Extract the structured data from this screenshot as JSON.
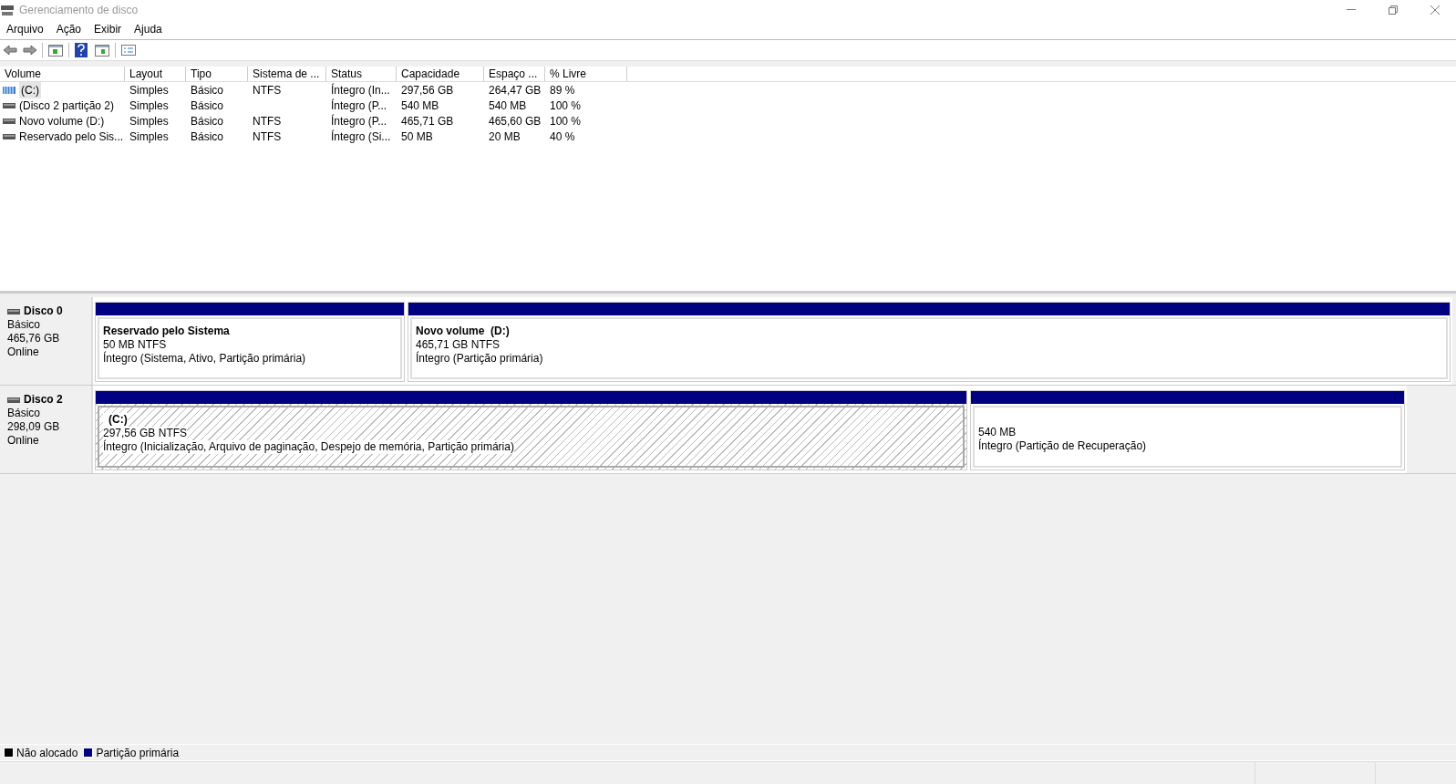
{
  "window": {
    "title": "Gerenciamento de disco"
  },
  "menu": [
    "Arquivo",
    "Ação",
    "Exibir",
    "Ajuda"
  ],
  "table": {
    "columns": [
      "Volume",
      "Layout",
      "Tipo",
      "Sistema de ...",
      "Status",
      "Capacidade",
      "Espaço ...",
      "% Livre"
    ],
    "rows": [
      {
        "kind": "boot",
        "selected": true,
        "cells": [
          "(C:)",
          "Simples",
          "Básico",
          "NTFS",
          "Íntegro (In...",
          "297,56 GB",
          "264,47 GB",
          "89 %"
        ]
      },
      {
        "kind": "drive",
        "selected": false,
        "cells": [
          "(Disco 2 partição 2)",
          "Simples",
          "Básico",
          "",
          "Íntegro (P...",
          "540 MB",
          "540 MB",
          "100 %"
        ]
      },
      {
        "kind": "drive",
        "selected": false,
        "cells": [
          "Novo volume (D:)",
          "Simples",
          "Básico",
          "NTFS",
          "Íntegro (P...",
          "465,71 GB",
          "465,60 GB",
          "100 %"
        ]
      },
      {
        "kind": "drive",
        "selected": false,
        "cells": [
          "Reservado pelo Sis...",
          "Simples",
          "Básico",
          "NTFS",
          "Íntegro (Si...",
          "50 MB",
          "20 MB",
          "40 %"
        ]
      }
    ]
  },
  "disks": [
    {
      "name": "Disco 0",
      "type": "Básico",
      "size": "465,76 GB",
      "state": "Online",
      "partitions": [
        {
          "selected": false,
          "title": "Reservado pelo Sistema",
          "size": "50 MB NTFS",
          "status": "Íntegro (Sistema, Ativo, Partição primária)"
        },
        {
          "selected": false,
          "title": "Novo volume  (D:)",
          "size": "465,71 GB NTFS",
          "status": "Íntegro (Partição primária)"
        }
      ]
    },
    {
      "name": "Disco 2",
      "type": "Básico",
      "size": "298,09 GB",
      "state": "Online",
      "partitions": [
        {
          "selected": true,
          "title": "(C:)",
          "size": "297,56 GB NTFS",
          "status": "Íntegro (Inicialização, Arquivo de paginação, Despejo de memória, Partição primária)"
        },
        {
          "selected": false,
          "size": "540 MB",
          "status": "Íntegro (Partição de Recuperação)"
        }
      ]
    }
  ],
  "legend": [
    {
      "label": "Não alocado",
      "color": "#000000"
    },
    {
      "label": "Partição primária",
      "color": "#000080"
    }
  ]
}
